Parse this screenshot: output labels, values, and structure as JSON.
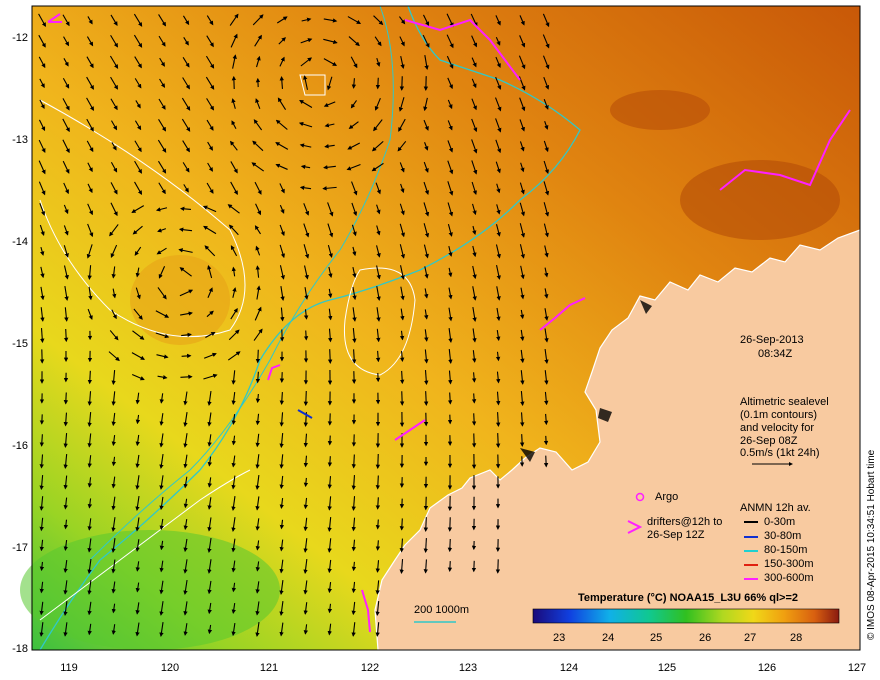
{
  "map": {
    "lon_ticks": [
      "119",
      "120",
      "121",
      "122",
      "123",
      "124",
      "125",
      "126",
      "127"
    ],
    "lat_ticks": [
      "-12",
      "-13",
      "-14",
      "-15",
      "-16",
      "-17",
      "-18"
    ],
    "date": "26-Sep-2013",
    "time": "08:34Z",
    "altimetry_note": [
      "Altimetric sealevel",
      "(0.1m contours)",
      "and velocity for",
      "26-Sep 08Z",
      "0.5m/s (1kt 24h)"
    ],
    "argo_label": "Argo",
    "drifters_label": [
      "drifters@12h to",
      "26-Sep 12Z"
    ],
    "anmn_title": "ANMN 12h av.",
    "anmn_depths": [
      {
        "label": "0-30m",
        "color": "#000000"
      },
      {
        "label": "30-80m",
        "color": "#1030d0"
      },
      {
        "label": "80-150m",
        "color": "#20d0d0"
      },
      {
        "label": "150-300m",
        "color": "#e02010"
      },
      {
        "label": "300-600m",
        "color": "#ff20ff"
      }
    ],
    "isobath_label": "200  1000m",
    "colorbar_title": "Temperature (°C) NOAA15_L3U 66% ql>=2",
    "colorbar_ticks": [
      "23",
      "24",
      "25",
      "26",
      "27",
      "28"
    ],
    "credit": "© IMOS 08-Apr-2015 10:34:51 Hobart time",
    "colors": {
      "land": "#f8caa0",
      "drifter": "#ff20ff",
      "isobath": "#30c8c8",
      "contour": "#ffffff"
    }
  }
}
